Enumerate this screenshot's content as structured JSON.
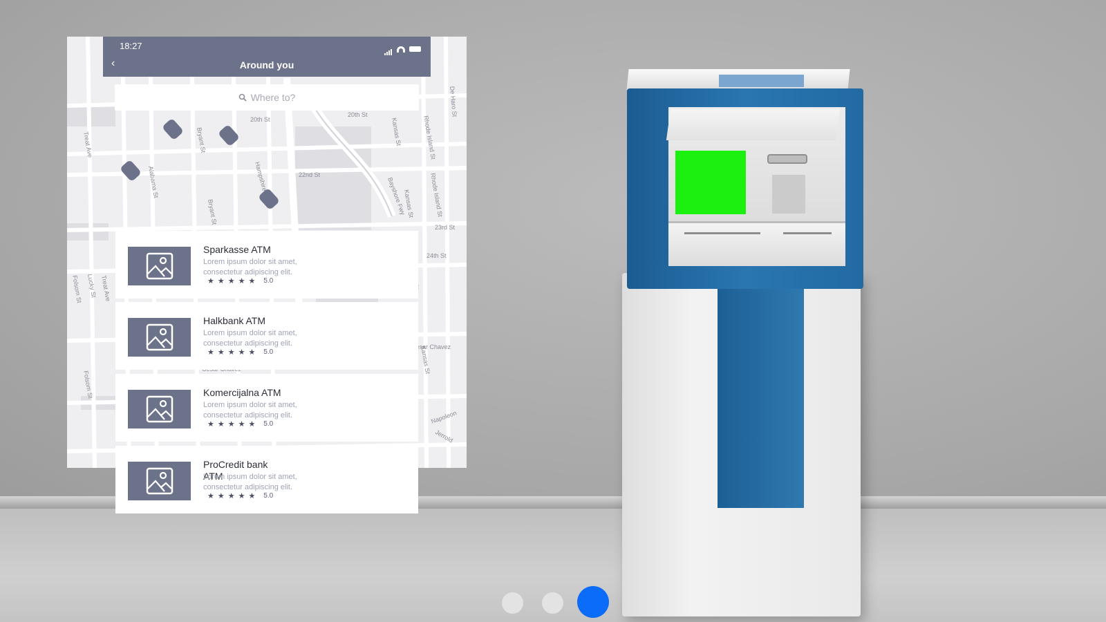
{
  "status_bar": {
    "time": "18:27"
  },
  "nav": {
    "back_icon": "‹",
    "title": "Around you"
  },
  "search": {
    "placeholder": "Where to?"
  },
  "map": {
    "streets": [
      "20th St",
      "20th St",
      "22nd St",
      "23rd St",
      "24th St",
      "Treat Ave",
      "Treat Ave",
      "Alabama St",
      "Bryant St",
      "Bryant St",
      "Hampshire St",
      "Kansas St",
      "Kansas St",
      "Kansas St",
      "Kansas St",
      "Rhode Island St",
      "Rhode Island St",
      "De Haro St",
      "Bayshore Fwy",
      "Folsom St",
      "Folsom St",
      "Lucky St",
      "Cesar Chavez",
      "Cesar Chavez",
      "Napoleon",
      "Jerrold"
    ],
    "pins": 5
  },
  "atms": [
    {
      "name": "Sparkasse ATM",
      "desc": "Lorem ipsum dolor sit amet, consectetur adipiscing elit.",
      "stars": "★★★★★",
      "rating": "5.0"
    },
    {
      "name": "Halkbank ATM",
      "desc": "Lorem ipsum dolor sit amet, consectetur adipiscing elit.",
      "stars": "★★★★★",
      "rating": "5.0"
    },
    {
      "name": "Komercijalna ATM",
      "desc": "Lorem ipsum dolor sit amet, consectetur adipiscing elit.",
      "stars": "★★★★★",
      "rating": "5.0"
    },
    {
      "name": "ProCredit bank ATM",
      "desc": "Lorem ipsum dolor sit amet, consectetur adipiscing elit.",
      "stars": "★★★★★",
      "rating": "5.0"
    }
  ],
  "pager": {
    "count": 3,
    "active": 3,
    "active_color": "#0a6cf8",
    "inactive_color": "#e3e3e3"
  },
  "theme": {
    "accent": "#6c7289",
    "atm_screen": "#1cf00f",
    "atm_body": "#2a76b1"
  }
}
